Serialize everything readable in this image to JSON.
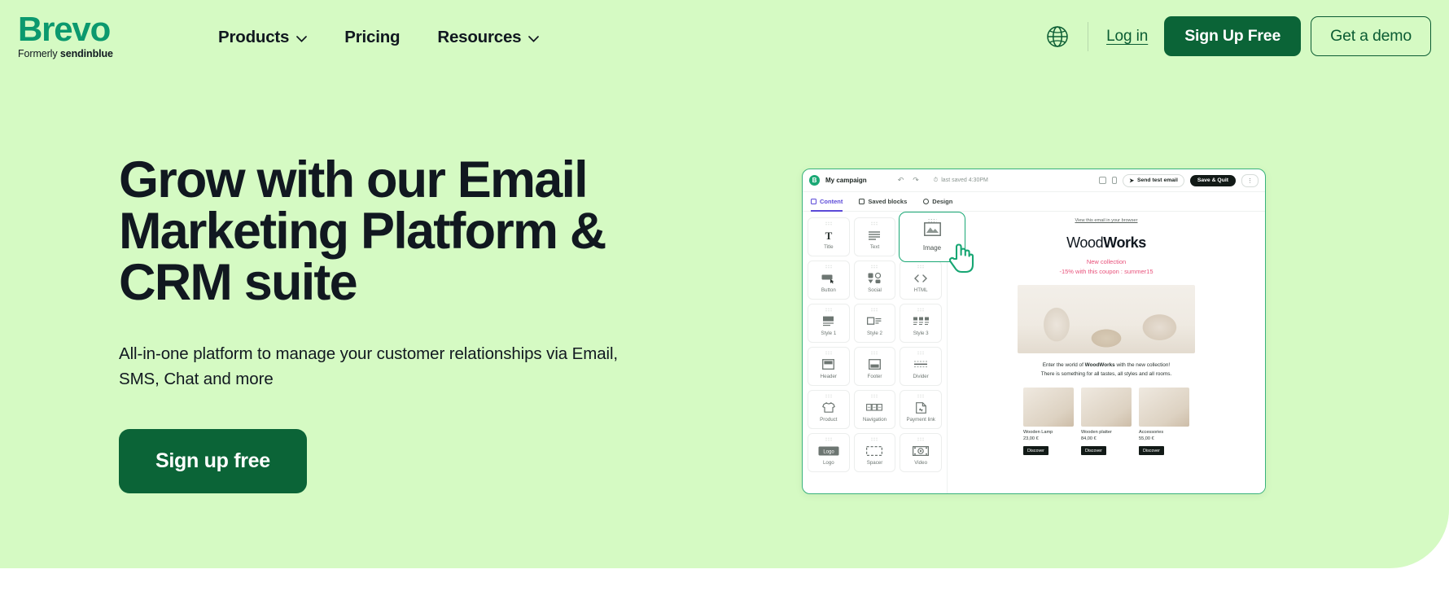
{
  "theme": {
    "bg_green": "#d5fac3",
    "brand_green": "#0b996e",
    "dark_green": "#0b6437",
    "link_green": "#0b5c33",
    "accent_purple": "#5b4ad8",
    "promo_pink": "#e8517a"
  },
  "header": {
    "logo": {
      "word": "Brevo",
      "formerly_prefix": "Formerly",
      "formerly_name": "sendinblue"
    },
    "nav": [
      {
        "label": "Products",
        "has_caret": true,
        "icon": "chevron-down-icon"
      },
      {
        "label": "Pricing",
        "has_caret": false,
        "icon": ""
      },
      {
        "label": "Resources",
        "has_caret": true,
        "icon": "chevron-down-icon"
      }
    ],
    "language_icon": "globe-icon",
    "login_label": "Log in",
    "signup_label": "Sign Up Free",
    "demo_label": "Get a demo"
  },
  "hero": {
    "headline_line1": "Grow with our Email",
    "headline_line2": "Marketing Platform &",
    "headline_line3": "CRM suite",
    "subheading": "All-in-one platform to manage your customer relationships via Email, SMS, Chat and more",
    "cta_label": "Sign up free"
  },
  "mockup": {
    "topbar": {
      "app_badge": "B",
      "campaign_name": "My campaign",
      "undo_icon": "undo-arrow-icon",
      "redo_icon": "redo-arrow-icon",
      "clock_icon": "clock-icon",
      "saved_status": "last saved 4:30PM",
      "desktop_icon": "desktop-preview-icon",
      "mobile_icon": "mobile-preview-icon",
      "send_test_label": "Send test email",
      "send_test_icon": "paper-plane-icon",
      "save_quit_label": "Save & Quit",
      "more_icon": "more-options-icon"
    },
    "tabs": [
      {
        "label": "Content",
        "icon": "content-panel-icon",
        "active": true
      },
      {
        "label": "Saved blocks",
        "icon": "saved-blocks-icon",
        "active": false
      },
      {
        "label": "Design",
        "icon": "design-gear-icon",
        "active": false
      }
    ],
    "blocks": [
      {
        "label": "Title",
        "icon": "title-T-icon",
        "dim": false
      },
      {
        "label": "Text",
        "icon": "text-lines-icon",
        "dim": false
      },
      {
        "label": "Image",
        "icon": "image-icon",
        "dim": true
      },
      {
        "label": "Button",
        "icon": "button-icon",
        "dim": false
      },
      {
        "label": "Social",
        "icon": "social-icons-icon",
        "dim": false
      },
      {
        "label": "HTML",
        "icon": "html-code-icon",
        "dim": false
      },
      {
        "label": "Style 1",
        "icon": "style-1-icon",
        "dim": false
      },
      {
        "label": "Style 2",
        "icon": "style-2-icon",
        "dim": false
      },
      {
        "label": "Style 3",
        "icon": "style-3-icon",
        "dim": false
      },
      {
        "label": "Header",
        "icon": "header-block-icon",
        "dim": false
      },
      {
        "label": "Footer",
        "icon": "footer-block-icon",
        "dim": false
      },
      {
        "label": "Divider",
        "icon": "divider-icon",
        "dim": false
      },
      {
        "label": "Product",
        "icon": "product-shirt-icon",
        "dim": false
      },
      {
        "label": "Navigation",
        "icon": "navigation-icon",
        "dim": false
      },
      {
        "label": "Payment link",
        "icon": "payment-link-icon",
        "dim": false
      },
      {
        "label": "Logo",
        "icon": "logo-block-icon",
        "dim": false
      },
      {
        "label": "Spacer",
        "icon": "spacer-icon",
        "dim": false
      },
      {
        "label": "Video",
        "icon": "video-icon",
        "dim": false
      }
    ],
    "drag": {
      "label": "Image",
      "icon": "image-icon",
      "cursor_icon": "pointing-hand-cursor-icon"
    },
    "email": {
      "view_in_browser": "View this email in your browser",
      "brand_light": "Wood",
      "brand_bold": "Works",
      "promo_line1": "New collection",
      "promo_line2": "-15% with this coupon : summer15",
      "blurb_pre": "Enter the world of ",
      "blurb_brand": "WoodWorks",
      "blurb_post": " with the new collection!",
      "blurb_line2": "There is something for all tastes, all styles and all rooms.",
      "products": [
        {
          "name": "Wooden Lamp",
          "price": "23,00 €",
          "cta": "Discover"
        },
        {
          "name": "Wooden platter",
          "price": "84,00 €",
          "cta": "Discover"
        },
        {
          "name": "Accessories",
          "price": "55,00 €",
          "cta": "Discover"
        }
      ]
    }
  }
}
